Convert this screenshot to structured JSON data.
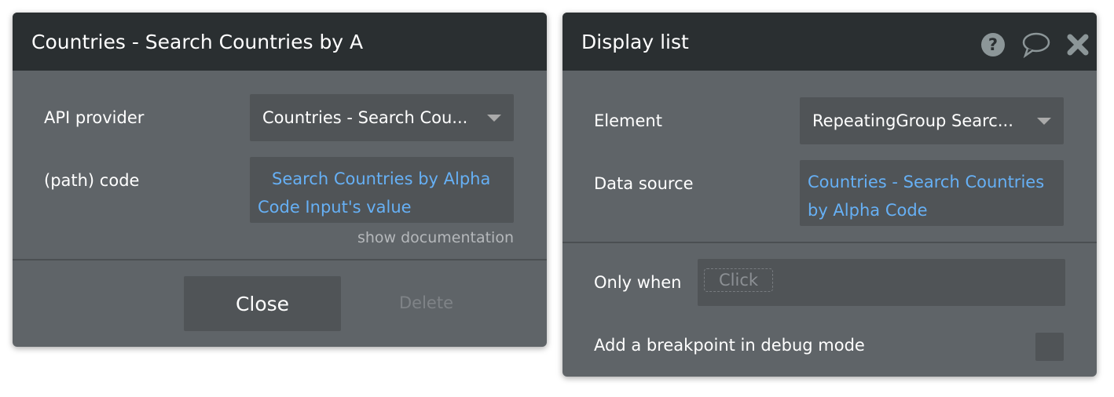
{
  "left": {
    "title": "Countries - Search Countries by A",
    "api_label": "API provider",
    "api_value": "Countries - Search Cou...",
    "path_label": "(path) code",
    "path_value": "Search Countries by Alpha Code Input's value",
    "doc_link": "show documentation",
    "close": "Close",
    "delete": "Delete"
  },
  "right": {
    "title": "Display list",
    "icons": [
      "help-icon",
      "comment-icon",
      "close-icon"
    ],
    "element_label": "Element",
    "element_value": "RepeatingGroup Searc...",
    "source_label": "Data source",
    "source_value": "Countries - Search Countries by Alpha Code",
    "only_when_label": "Only when",
    "only_when_placeholder": "Click",
    "breakpoint_label": "Add a breakpoint in debug mode",
    "breakpoint_checked": false
  },
  "colors": {
    "header": "#2a2f31",
    "body": "#5f6468",
    "field": "#505457",
    "link": "#66b0f5"
  }
}
